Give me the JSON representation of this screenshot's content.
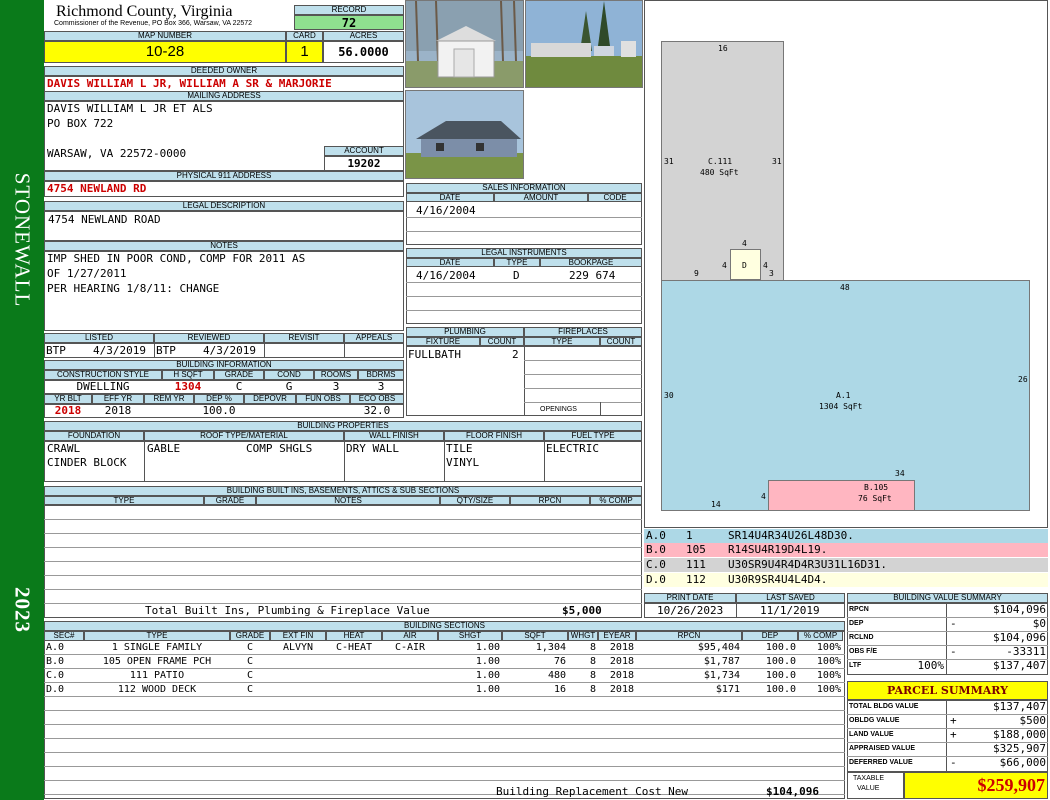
{
  "county": "Richmond County, Virginia",
  "commissioner": "Commissioner of the Revenue, PO Box 366, Warsaw, VA 22572",
  "side": {
    "district": "STONEWALL",
    "year": "2023"
  },
  "record": {
    "label": "RECORD",
    "value": "72"
  },
  "map": {
    "label": "MAP NUMBER",
    "value": "10-28"
  },
  "card": {
    "label": "CARD",
    "value": "1"
  },
  "acres": {
    "label": "ACRES",
    "value": "56.0000"
  },
  "owner": {
    "label": "DEEDED OWNER",
    "value": "DAVIS WILLIAM L JR, WILLIAM A SR & MARJORIE"
  },
  "mailing": {
    "label": "MAILING ADDRESS",
    "line1": "DAVIS WILLIAM L JR ET ALS",
    "line2": "PO BOX 722",
    "line3": "WARSAW, VA 22572-0000"
  },
  "account": {
    "label": "ACCOUNT",
    "value": "19202"
  },
  "physical": {
    "label": "PHYSICAL 911 ADDRESS",
    "value": "4754 NEWLAND RD"
  },
  "legal": {
    "label": "LEGAL DESCRIPTION",
    "value": "4754 NEWLAND ROAD"
  },
  "notes": {
    "label": "NOTES",
    "line1": "IMP SHED IN POOR COND, COMP FOR 2011 AS",
    "line2": "OF 1/27/2011",
    "line3": "PER HEARING 1/8/11: CHANGE"
  },
  "sales": {
    "label": "SALES INFORMATION",
    "h_date": "DATE",
    "h_amount": "AMOUNT",
    "h_code": "CODE",
    "date": "4/16/2004"
  },
  "instruments": {
    "label": "LEGAL INSTRUMENTS",
    "h_date": "DATE",
    "h_type": "TYPE",
    "h_book": "BOOKPAGE",
    "date": "4/16/2004",
    "type": "D",
    "book": "229 674"
  },
  "dates": {
    "listed_label": "LISTED",
    "reviewed_label": "REVIEWED",
    "revisit_label": "REVISIT",
    "appeals_label": "APPEALS",
    "listed_by": "BTP",
    "listed": "4/3/2019",
    "reviewed_by": "BTP",
    "reviewed": "4/3/2019"
  },
  "plumbing": {
    "label": "PLUMBING",
    "h_fixture": "FIXTURE",
    "h_count": "COUNT",
    "fixture": "FULLBATH",
    "count": "2"
  },
  "fireplaces": {
    "label": "FIREPLACES",
    "h_type": "TYPE",
    "h_count": "COUNT",
    "openings": "OPENINGS"
  },
  "building": {
    "label": "BUILDING INFORMATION",
    "h_style": "CONSTRUCTION STYLE",
    "h_sqft": "H SQFT",
    "h_grade": "GRADE",
    "h_cond": "COND",
    "h_rooms": "ROOMS",
    "h_bdrms": "BDRMS",
    "style": "DWELLING",
    "sqft": "1304",
    "grade": "C",
    "cond": "G",
    "rooms": "3",
    "bdrms": "3",
    "h_yrblt": "YR BLT",
    "h_effyr": "EFF YR",
    "h_remyr": "REM YR",
    "h_dep": "DEP %",
    "h_depovr": "DEPOVR",
    "h_funobs": "FUN OBS",
    "h_ecoobs": "ECO OBS",
    "yrblt": "2018",
    "effyr": "2018",
    "dep": "100.0",
    "ecoobs": "32.0"
  },
  "properties": {
    "label": "BUILDING PROPERTIES",
    "h_foundation": "FOUNDATION",
    "h_roof": "ROOF TYPE/MATERIAL",
    "h_wall": "WALL FINISH",
    "h_floor": "FLOOR FINISH",
    "h_fuel": "FUEL TYPE",
    "foundation1": "CRAWL",
    "foundation2": "CINDER BLOCK",
    "roof1": "GABLE",
    "roof2": "COMP SHGLS",
    "wall": "DRY WALL",
    "floor1": "TILE",
    "floor2": "VINYL",
    "fuel": "ELECTRIC"
  },
  "builtins": {
    "label": "BUILDING BUILT INS, BASEMENTS, ATTICS & SUB SECTIONS",
    "h_type": "TYPE",
    "h_grade": "GRADE",
    "h_notes": "NOTES",
    "h_qty": "QTY/SIZE",
    "h_rpcn": "RPCN",
    "h_comp": "% COMP",
    "total_label": "Total Built Ins, Plumbing & Fireplace Value",
    "total": "$5,000"
  },
  "print": {
    "print_label": "PRINT DATE",
    "saved_label": "LAST SAVED",
    "print": "10/26/2023",
    "saved": "11/1/2019"
  },
  "legend": [
    {
      "code": "A.0",
      "num": "1",
      "path": "SR14U4R34U26L48D30.",
      "color": "#add8e6"
    },
    {
      "code": "B.0",
      "num": "105",
      "path": "R14SU4R19D4L19.",
      "color": "#ffb6c1"
    },
    {
      "code": "C.0",
      "num": "111",
      "path": "U30SR9U4R4D4R3U31L16D31.",
      "color": "#d3d3d3"
    },
    {
      "code": "D.0",
      "num": "112",
      "path": "U30R9SR4U4L4D4.",
      "color": "#ffffe0"
    }
  ],
  "sketch": {
    "c_label": "C.111",
    "c_area": "480 SqFt",
    "c_top": "16",
    "c_left": "31",
    "c_right": "31",
    "d_label": "D",
    "d_top": "4",
    "d_left": "4",
    "d_right": "4",
    "d_nine": "9",
    "d_three": "3",
    "a_label": "A.1",
    "a_area": "1304 SqFt",
    "a_top": "48",
    "a_left": "30",
    "a_right": "26",
    "a_bottom": "14",
    "b_label": "B.105",
    "b_area": "76 SqFt",
    "b_top": "34",
    "b_left": "4"
  },
  "sections": {
    "label": "BUILDING SECTIONS",
    "headers": [
      "SEC#",
      "TYPE",
      "GRADE",
      "EXT FIN",
      "HEAT",
      "AIR",
      "SHGT",
      "SQFT",
      "WHGT",
      "EYEAR",
      "RPCN",
      "DEP",
      "% COMP"
    ],
    "rows": [
      {
        "sec": "A.0",
        "type": "1 SINGLE FAMILY",
        "grade": "C",
        "ext": "ALVYN",
        "heat": "C-HEAT",
        "air": "C-AIR",
        "shgt": "1.00",
        "sqft": "1,304",
        "whgt": "8",
        "eyear": "2018",
        "rpcn": "$95,404",
        "dep": "100.0",
        "comp": "100%"
      },
      {
        "sec": "B.0",
        "type": "105 OPEN FRAME PCH",
        "grade": "C",
        "ext": "",
        "heat": "",
        "air": "",
        "shgt": "1.00",
        "sqft": "76",
        "whgt": "8",
        "eyear": "2018",
        "rpcn": "$1,787",
        "dep": "100.0",
        "comp": "100%"
      },
      {
        "sec": "C.0",
        "type": "111 PATIO",
        "grade": "C",
        "ext": "",
        "heat": "",
        "air": "",
        "shgt": "1.00",
        "sqft": "480",
        "whgt": "8",
        "eyear": "2018",
        "rpcn": "$1,734",
        "dep": "100.0",
        "comp": "100%"
      },
      {
        "sec": "D.0",
        "type": "112 WOOD DECK",
        "grade": "C",
        "ext": "",
        "heat": "",
        "air": "",
        "shgt": "1.00",
        "sqft": "16",
        "whgt": "8",
        "eyear": "2018",
        "rpcn": "$171",
        "dep": "100.0",
        "comp": "100%"
      }
    ],
    "brcn_label": "Building Replacement Cost New",
    "brcn": "$104,096"
  },
  "bvs": {
    "label": "BUILDING VALUE SUMMARY",
    "rpcn_l": "RPCN",
    "rpcn": "$104,096",
    "dep_l": "DEP",
    "dep_s": "-",
    "dep": "$0",
    "rclnd_l": "RCLND",
    "rclnd": "$104,096",
    "obs_l": "OBS F/E",
    "obs_s": "-",
    "obs": "-33311",
    "ltf_l": "LTF",
    "ltf_p": "100%",
    "ltf": "$137,407"
  },
  "parcel": {
    "label": "PARCEL SUMMARY",
    "tbv_l": "TOTAL BLDG VALUE",
    "tbv": "$137,407",
    "obv_l": "OBLDG VALUE",
    "obv_s": "+",
    "obv": "$500",
    "land_l": "LAND VALUE",
    "land_s": "+",
    "land": "$188,000",
    "app_l": "APPRAISED VALUE",
    "app": "$325,907",
    "def_l": "DEFERRED VALUE",
    "def_s": "-",
    "def": "$66,000",
    "tax_l1": "TAXABLE",
    "tax_l2": "VALUE",
    "tax": "$259,907"
  }
}
